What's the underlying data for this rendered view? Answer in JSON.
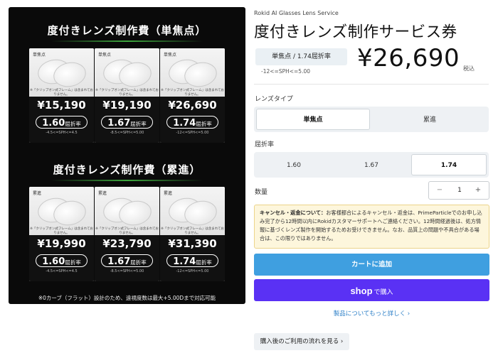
{
  "promo": {
    "title_single": "度付きレンズ制作費（単焦点）",
    "title_progressive": "度付きレンズ制作費（累進）",
    "card_tag_single": "単焦点",
    "card_tag_progressive": "累進",
    "card_note": "※「クリップオン式フレーム」は含まれておりません。",
    "refraction_label": "屈折率",
    "single_cards": [
      {
        "price": "¥15,190",
        "index": "1.60",
        "range": "-4.5<=SPH<=4.5"
      },
      {
        "price": "¥19,190",
        "index": "1.67",
        "range": "-8.5<=SPH<=5.00"
      },
      {
        "price": "¥26,690",
        "index": "1.74",
        "range": "-12<=SPH<=5.00"
      }
    ],
    "progressive_cards": [
      {
        "price": "¥19,990",
        "index": "1.60",
        "range": "-4.5<=SPH<=4.5"
      },
      {
        "price": "¥23,790",
        "index": "1.67",
        "range": "-8.5<=SPH<=5.00"
      },
      {
        "price": "¥31,390",
        "index": "1.74",
        "range": "-12<=SPH<=5.00"
      }
    ],
    "footnote": "※0カーブ（フラット）設計のため、遠視度数は最大+5.00Dまで対応可能"
  },
  "product": {
    "brand": "Rokid AI Glasses Lens Service",
    "title": "度付きレンズ制作サービス券",
    "selected_variant": "単焦点 / 1.74屈折率",
    "selected_range": "-12<=SPH<=5.00",
    "price": "¥26,690",
    "tax_label": "税込"
  },
  "lens_type": {
    "label": "レンズタイプ",
    "options": [
      "単焦点",
      "累進"
    ],
    "selected": "単焦点"
  },
  "refraction": {
    "label": "屈折率",
    "options": [
      "1.60",
      "1.67",
      "1.74"
    ],
    "selected": "1.74"
  },
  "quantity": {
    "label": "数量",
    "value": "1",
    "minus": "−",
    "plus": "+"
  },
  "notice": {
    "heading": "キャンセル・返金について：",
    "body": "お客様都合によるキャンセル・返金は、PrimeParticleでのお申し込み完了から12時間以内にRokidカスタマーサポートへご連絡ください。12時間経過後は、処方情報に基づくレンズ製作を開始するためお受けできません。なお、品質上の問題や不具合がある場合は、この限りではありません。"
  },
  "actions": {
    "add_to_cart": "カートに追加",
    "shop_logo": "shop",
    "shop_buy": "で購入",
    "more_details": "製品についてもっと詳しく ›",
    "flow": "購入後のご利用の流れを見る ›"
  },
  "colors": {
    "cart_button": "#3f9fe0",
    "shop_button": "#5a31f4",
    "notice_bg": "#fdf6dc",
    "link": "#2c7fc7"
  }
}
